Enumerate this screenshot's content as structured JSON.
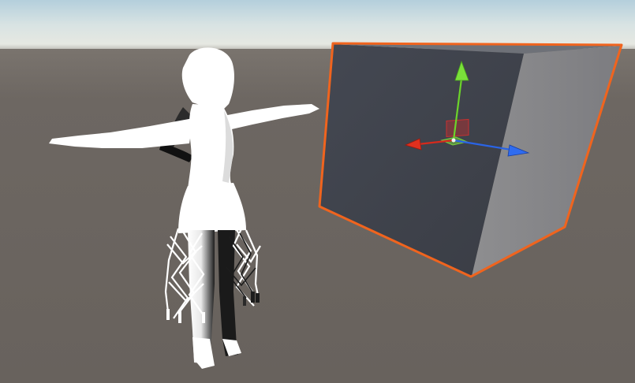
{
  "scene": {
    "colors": {
      "sky_top": "#b9d3df",
      "sky_mid": "#dfe6e3",
      "horizon": "#8a8580",
      "ground": "#6b6560",
      "cube_front": "#3f434c",
      "cube_side": "#8a8a8c",
      "cube_top": "#70737a",
      "selection_outline": "#f0641e",
      "axis_x": "#d62a1c",
      "axis_y": "#6cd42a",
      "axis_z": "#2a64e6",
      "character_body": "#ffffff",
      "character_shadow": "#1a1a1a"
    },
    "objects": [
      {
        "name": "character",
        "selected": false
      },
      {
        "name": "cube",
        "selected": true
      }
    ],
    "gizmo": {
      "tool": "move",
      "handles": [
        "x-axis",
        "y-axis",
        "z-axis",
        "xy-plane",
        "xz-plane"
      ]
    }
  }
}
